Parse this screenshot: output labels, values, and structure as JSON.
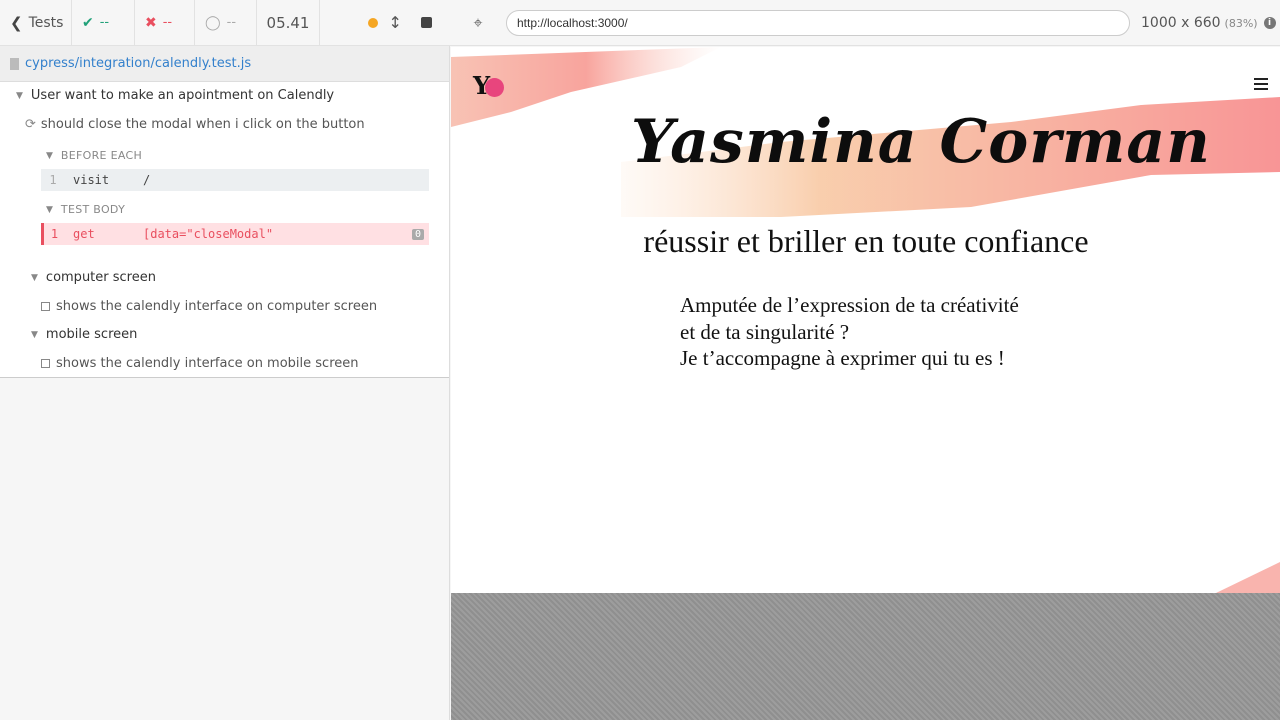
{
  "reporter": {
    "header": {
      "tests_label": "Tests",
      "passed": "--",
      "failed": "--",
      "pending": "--",
      "duration": "05.41"
    },
    "spec_file": "cypress/integration/calendly.test.js",
    "root_suite": "User want to make an apointment on Calendly",
    "running_test": "should close the modal when i click on the button",
    "hooks": {
      "before_each_label": "BEFORE EACH",
      "test_body_label": "TEST BODY"
    },
    "commands": {
      "visit": {
        "number": "1",
        "name": "visit",
        "message": "/"
      },
      "get": {
        "number": "1",
        "name": "get",
        "message": "[data=\"closeModal\"",
        "badge": "0"
      }
    },
    "suites": [
      {
        "title": "computer screen",
        "test": "shows the calendly interface on computer screen"
      },
      {
        "title": "mobile screen",
        "test": "shows the calendly interface on mobile screen"
      }
    ],
    "colors": {
      "passed": "#21a179",
      "failed": "#e94f5f",
      "running": "#f5a623"
    }
  },
  "aut": {
    "url": "http://localhost:3000/",
    "viewport": "1000 x 660",
    "scale": "(83%)",
    "page": {
      "logo_text": "Y",
      "name": "Yasmina Corman",
      "tagline": "réussir et briller en toute confiance",
      "lines": [
        "Amputée de l’expression de ta créativité",
        "et de ta singularité ?",
        "Je t’accompagne à exprimer qui tu es !"
      ],
      "accent": "#f7948c"
    }
  }
}
